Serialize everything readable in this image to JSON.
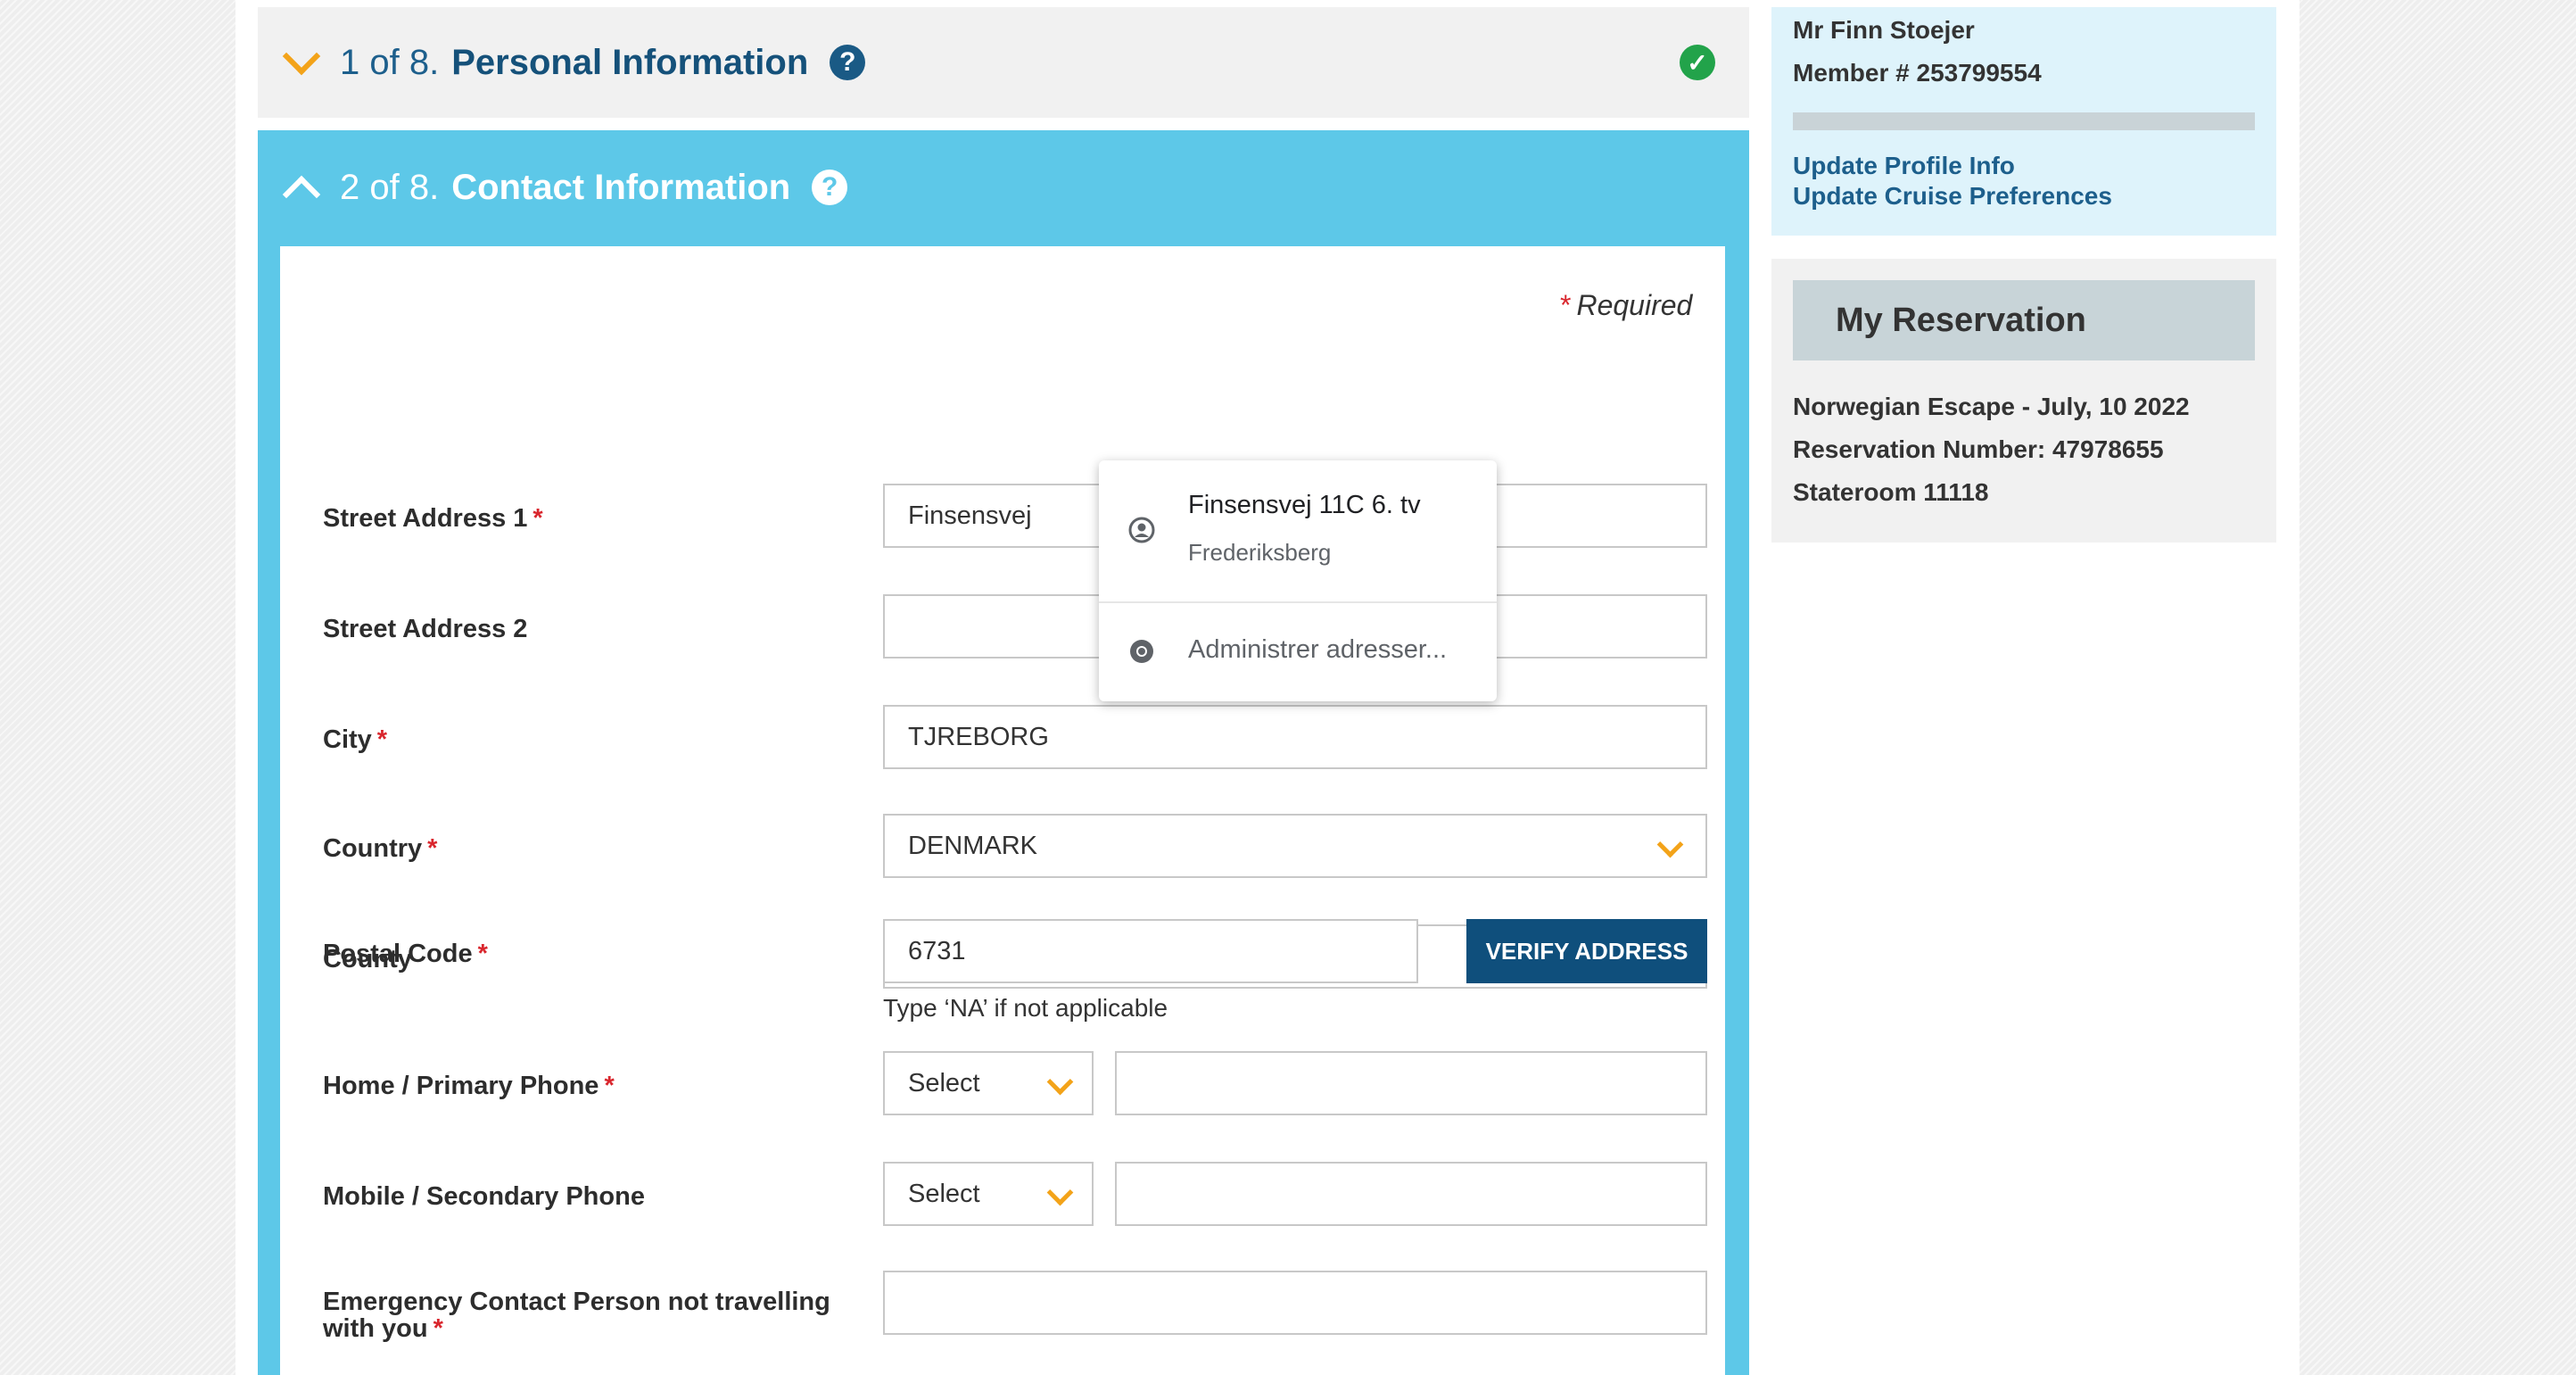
{
  "sections": {
    "personal": {
      "step": "1 of 8.",
      "title": "Personal Information",
      "help": "?",
      "complete_mark": "✓"
    },
    "contact": {
      "step": "2 of 8.",
      "title": "Contact Information",
      "help": "?"
    }
  },
  "form": {
    "required_note": {
      "star": "*",
      "text": "Required"
    },
    "street1": {
      "label": "Street Address 1",
      "value": "Finsensvej",
      "required": "*"
    },
    "street2": {
      "label": "Street Address 2",
      "value": ""
    },
    "city": {
      "label": "City",
      "value": "TJREBORG",
      "required": "*"
    },
    "country": {
      "label": "Country",
      "value": "DENMARK",
      "required": "*"
    },
    "county": {
      "label": "County",
      "value": ""
    },
    "postal": {
      "label": "Postal Code",
      "value": "6731",
      "required": "*",
      "hint": "Type ‘NA’ if not applicable",
      "verify_label": "VERIFY ADDRESS"
    },
    "home_phone": {
      "label": "Home / Primary Phone",
      "required": "*",
      "select": "Select",
      "value": ""
    },
    "mobile_phone": {
      "label": "Mobile / Secondary Phone",
      "select": "Select",
      "value": ""
    },
    "emergency": {
      "label_line1": "Emergency Contact Person not travelling",
      "label_line2": "with you",
      "required": "*",
      "value": ""
    }
  },
  "autocomplete": {
    "suggestion_main": "Finsensvej 11C 6. tv",
    "suggestion_sub": "Frederiksberg",
    "manage": "Administrer adresser..."
  },
  "profile": {
    "name": "Mr Finn Stoejer",
    "member": "Member # 253799554",
    "update_profile": "Update Profile Info",
    "update_cruise": "Update Cruise Preferences"
  },
  "reservation": {
    "title": "My Reservation",
    "cruise": "Norwegian Escape - July, 10 2022",
    "number": "Reservation Number: 47978655",
    "stateroom": "Stateroom 11118"
  },
  "colors": {
    "accent_blue": "#5dc8e8",
    "dark_blue": "#0f4f7c",
    "chevron_orange": "#f3a319",
    "success_green": "#22a34a",
    "required_red": "#d9262d"
  }
}
